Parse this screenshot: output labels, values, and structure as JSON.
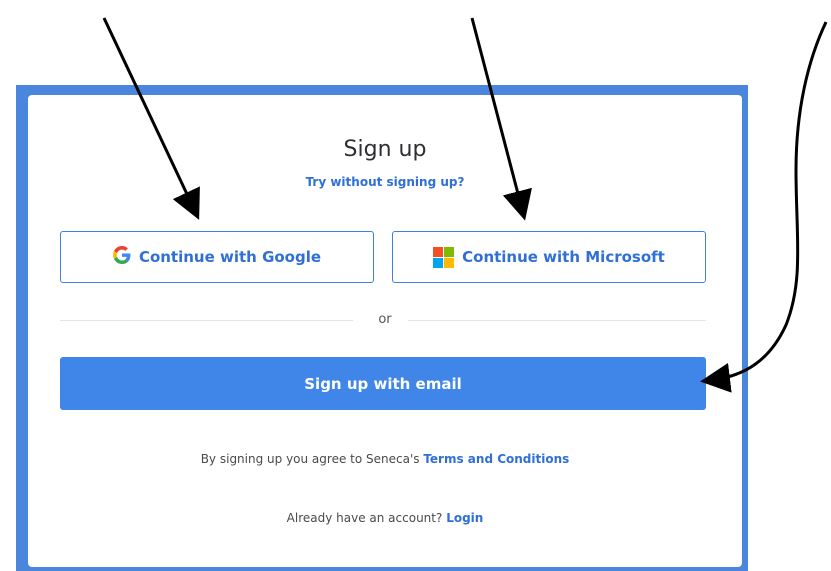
{
  "signup": {
    "title": "Sign up",
    "try_without": "Try without signing up?",
    "google_label": "Continue with Google",
    "microsoft_label": "Continue with Microsoft",
    "or": "or",
    "email_label": "Sign up with email",
    "terms_prefix": "By signing up you agree to Seneca's ",
    "terms_link": "Terms and Conditions",
    "login_prefix": "Already have an account? ",
    "login_link": "Login"
  },
  "icons": {
    "google": "google-logo-icon",
    "microsoft": "microsoft-logo-icon",
    "annotation": "arrow-icon"
  },
  "colors": {
    "brand_blue": "#3f86e8",
    "frame_blue": "#4a86dd",
    "link_blue": "#2f6fd6",
    "ms_red": "#f25022",
    "ms_green": "#7fba00",
    "ms_blue": "#00a4ef",
    "ms_yellow": "#ffb900"
  }
}
